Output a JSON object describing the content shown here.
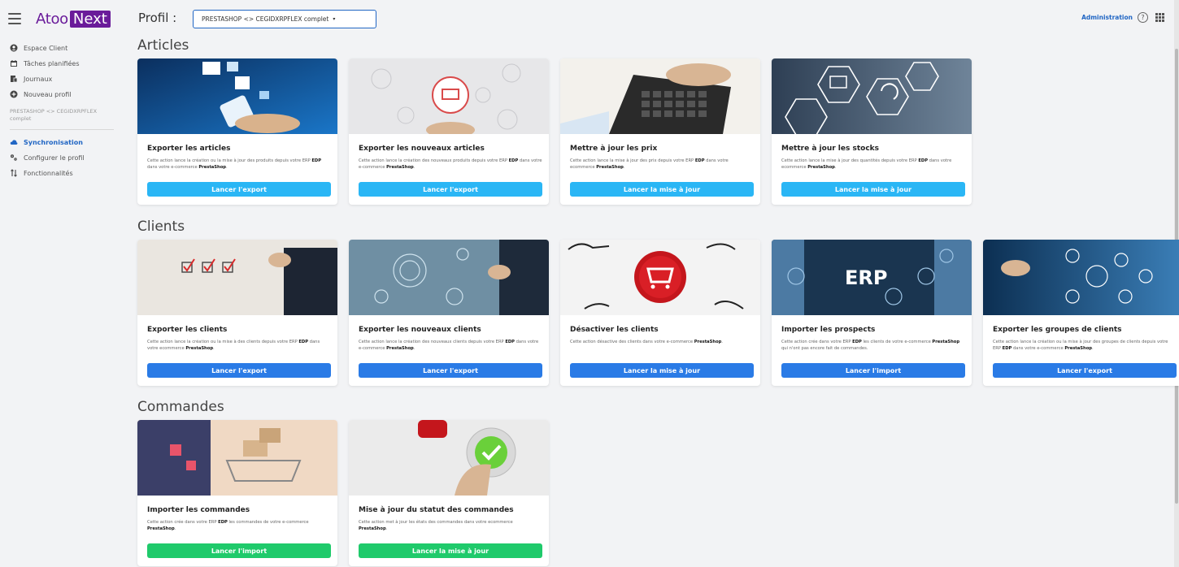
{
  "brand": {
    "logo_a": "Atoo",
    "logo_b": "Next"
  },
  "sidebar": {
    "items": [
      {
        "label": "Espace Client",
        "icon": "user-circle-icon"
      },
      {
        "label": "Tâches planifiées",
        "icon": "calendar-icon"
      },
      {
        "label": "Journaux",
        "icon": "logs-icon"
      },
      {
        "label": "Nouveau profil",
        "icon": "plus-circle-icon"
      }
    ],
    "profile_name": "PRESTASHOP <> CEGIDXRPFLEX complet",
    "profile_items": [
      {
        "label": "Synchronisation",
        "icon": "cloud-icon",
        "active": true
      },
      {
        "label": "Configurer le profil",
        "icon": "settings-icon"
      },
      {
        "label": "Fonctionnalités",
        "icon": "sort-icon"
      }
    ]
  },
  "header": {
    "profil_label": "Profil :",
    "profil_value": "PRESTASHOP <> CEGIDXRPFLEX complet",
    "admin_label": "Administration",
    "help_glyph": "?"
  },
  "colors": {
    "blue": "#2a9df4",
    "darkblue": "#2a6fe0",
    "green": "#1fca6b",
    "brand": "#6a1b9a"
  },
  "sections": [
    {
      "title": "Articles",
      "cards": [
        {
          "title": "Exporter les articles",
          "desc_a": "Cette action lance la création ou la mise à jour des produits depuis votre ERP ",
          "erp": "EDP",
          "desc_b": " dans votre e-commerce ",
          "shop": "PrestaShop",
          "desc_c": ".",
          "button": "Lancer l'export",
          "color": "#2ab6f5",
          "image": "phone-shopping-image"
        },
        {
          "title": "Exporter les nouveaux articles",
          "desc_a": "Cette action lance la création des nouveaux produits depuis votre ERP ",
          "erp": "EDP",
          "desc_b": " dans votre e-commerce ",
          "shop": "PrestaShop",
          "desc_c": ".",
          "button": "Lancer l'export",
          "color": "#2ab6f5",
          "image": "cart-network-image"
        },
        {
          "title": "Mettre à jour les prix",
          "desc_a": "Cette action lance la mise à jour des prix depuis votre ERP ",
          "erp": "EDP",
          "desc_b": " dans votre ecommerce ",
          "shop": "PrestaShop",
          "desc_c": ".",
          "button": "Lancer la mise à jour",
          "color": "#2ab6f5",
          "image": "calculator-image"
        },
        {
          "title": "Mettre à jour les stocks",
          "desc_a": "Cette action lance la mise à jour des quantités depuis votre ERP ",
          "erp": "EDP",
          "desc_b": " dans votre ecommerce ",
          "shop": "PrestaShop",
          "desc_c": ".",
          "button": "Lancer la mise à jour",
          "color": "#2ab6f5",
          "image": "stock-icons-image"
        }
      ]
    },
    {
      "title": "Clients",
      "cards": [
        {
          "title": "Exporter les clients",
          "desc_a": "Cette action lance la création ou la mise à des clients depuis votre ERP ",
          "erp": "EDP",
          "desc_b": " dans votre ecommerce ",
          "shop": "PrestaShop",
          "desc_c": ".",
          "button": "Lancer l'export",
          "color": "#2a7be6",
          "image": "checkboxes-image"
        },
        {
          "title": "Exporter les nouveaux clients",
          "desc_a": "Cette action lance la création des nouveaux clients depuis votre ERP ",
          "erp": "EDP",
          "desc_b": " dans votre e-commerce ",
          "shop": "PrestaShop",
          "desc_c": ".",
          "button": "Lancer l'export",
          "color": "#2a7be6",
          "image": "tech-touch-image"
        },
        {
          "title": "Désactiver les clients",
          "desc_a": "Cette action désactive des clients dans votre e-commerce ",
          "erp": "",
          "desc_b": "",
          "shop": "PrestaShop",
          "desc_c": ".",
          "button": "Lancer la mise à jour",
          "color": "#2a7be6",
          "image": "red-cart-button-image"
        },
        {
          "title": "Importer les prospects",
          "desc_a": "Cette action crée dans votre ERP ",
          "erp": "EDP",
          "desc_b": " les clients de votre e-commerce ",
          "shop": "PrestaShop",
          "desc_c": " qui n'ont pas encore fait de commandes.",
          "button": "Lancer l'import",
          "color": "#2a7be6",
          "image": "erp-image"
        },
        {
          "title": "Exporter les groupes de clients",
          "desc_a": "Cette action lance la création ou la mise à jour des groupes de clients depuis votre ERP ",
          "erp": "EDP",
          "desc_b": " dans votre e-commerce ",
          "shop": "PrestaShop",
          "desc_c": ".",
          "button": "Lancer l'export",
          "color": "#2a7be6",
          "image": "people-network-image"
        }
      ]
    },
    {
      "title": "Commandes",
      "cards": [
        {
          "title": "Importer les commandes",
          "desc_a": "Cette action crée dans votre ERP ",
          "erp": "EDP",
          "desc_b": " les commandes de votre e-commerce ",
          "shop": "PrestaShop",
          "desc_c": ".",
          "button": "Lancer l'import",
          "color": "#1fca6b",
          "image": "shopping-cart-boxes-image"
        },
        {
          "title": "Mise à jour du statut des commandes",
          "desc_a": "Cette action met à jour les états des commandes dans votre ecommerce ",
          "erp": "",
          "desc_b": "",
          "shop": "PrestaShop",
          "desc_c": ".",
          "button": "Lancer la mise à jour",
          "color": "#1fca6b",
          "image": "status-button-image"
        }
      ]
    }
  ]
}
